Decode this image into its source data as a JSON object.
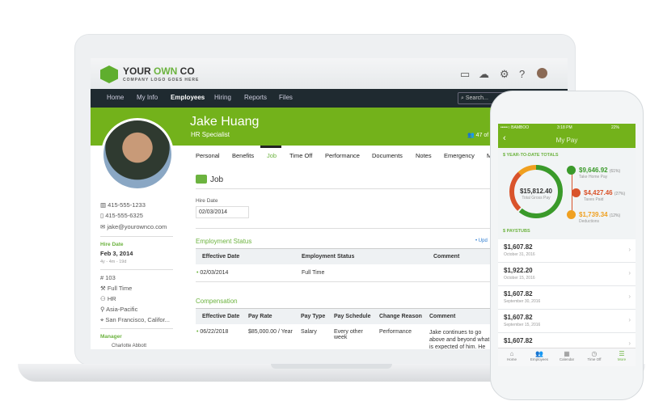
{
  "laptop": {
    "logo": {
      "title_a": "YOUR ",
      "title_b": "OWN",
      "title_c": " CO",
      "subtitle": "COMPANY LOGO GOES HERE"
    },
    "nav": [
      "Home",
      "My Info",
      "Employees",
      "Hiring",
      "Reports",
      "Files"
    ],
    "search_placeholder": "Search...",
    "employee": {
      "name": "Jake Huang",
      "title": "HR Specialist",
      "count": "47 of"
    },
    "tabs": [
      "Personal",
      "Benefits",
      "Job",
      "Time Off",
      "Performance",
      "Documents",
      "Notes",
      "Emergency",
      "M"
    ],
    "sidebar": {
      "work_phone": "415-555-1233",
      "mobile": "415-555-6325",
      "email": "jake@yourownco.com",
      "hire_label": "Hire Date",
      "hire_date": "Feb 3, 2014",
      "tenure": "4y - 4m - 19d",
      "emp_no": "103",
      "status": "Full Time",
      "dept": "HR",
      "division": "Asia-Pacific",
      "location": "San Francisco, Califor...",
      "manager_label": "Manager",
      "manager": "Charlotte Abbott"
    },
    "job": {
      "heading": "Job",
      "hire_label": "Hire Date",
      "hire_value": "02/03/2014",
      "employment": {
        "title": "Employment Status",
        "update": "• Upd",
        "headers": [
          "Effective Date",
          "Employment Status",
          "Comment"
        ],
        "row": [
          "02/03/2014",
          "Full Time",
          ""
        ]
      },
      "compensation": {
        "title": "Compensation",
        "headers": [
          "Effective Date",
          "Pay Rate",
          "Pay Type",
          "Pay Schedule",
          "Change Reason",
          "Comment"
        ],
        "row": [
          "06/22/2018",
          "$85,000.00 / Year",
          "Salary",
          "Every other week",
          "Performance",
          "Jake continues to go above and beyond what is expected of him. He takes"
        ]
      }
    }
  },
  "phone": {
    "status": {
      "carrier": "•••••○ BAMBOO",
      "time": "3:18 PM",
      "battery": "22%"
    },
    "title": "My Pay",
    "ytd_label": "YEAR-TO-DATE TOTALS",
    "gross": {
      "value": "$15,812.40",
      "label": "Total Gross Pay"
    },
    "breakdown": [
      {
        "value": "$9,646.92",
        "pct": "(61%)",
        "label": "Take Home Pay",
        "color": "#3a9a2a"
      },
      {
        "value": "$4,427.46",
        "pct": "(27%)",
        "label": "Taxes Paid",
        "color": "#d9532b"
      },
      {
        "value": "$1,739.34",
        "pct": "(12%)",
        "label": "Deductions",
        "color": "#f0a020"
      }
    ],
    "paystubs_label": "PAYSTUBS",
    "paystubs": [
      {
        "amount": "$1,607.82",
        "date": "October 31, 2016"
      },
      {
        "amount": "$1,922.20",
        "date": "October 15, 2016"
      },
      {
        "amount": "$1,607.82",
        "date": "September 30, 2016"
      },
      {
        "amount": "$1,607.82",
        "date": "September 15, 2016"
      },
      {
        "amount": "$1,607.82",
        "date": ""
      }
    ],
    "tabs": [
      "Home",
      "Employees",
      "Calendar",
      "Time Off",
      "More"
    ]
  }
}
